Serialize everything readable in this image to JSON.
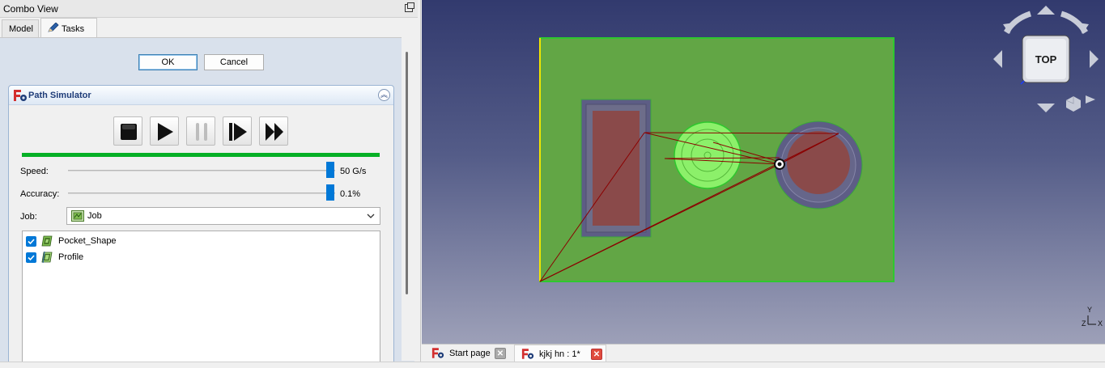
{
  "combo_view": {
    "title": "Combo View",
    "tabs": [
      {
        "label": "Model"
      },
      {
        "label": "Tasks"
      }
    ]
  },
  "dialog": {
    "ok_label": "OK",
    "cancel_label": "Cancel"
  },
  "path_simulator": {
    "title": "Path Simulator",
    "controls": [
      "stop",
      "play",
      "pause",
      "step-forward",
      "fast-forward"
    ],
    "progress": 1.0,
    "speed": {
      "label": "Speed:",
      "value": "50 G/s",
      "level": 1.0
    },
    "accuracy": {
      "label": "Accuracy:",
      "value": "0.1%",
      "level": 1.0
    },
    "job": {
      "label": "Job:",
      "selected": "Job"
    },
    "operations": [
      {
        "label": "Pocket_Shape",
        "checked": true,
        "icon": "pocket-shape-icon"
      },
      {
        "label": "Profile",
        "checked": true,
        "icon": "profile-icon"
      }
    ]
  },
  "navigation_cube": {
    "face": "TOP"
  },
  "axis_indicator": {
    "y": "Y",
    "z": "Z",
    "x": "X"
  },
  "document_tabs": [
    {
      "label": "Start page",
      "active": false
    },
    {
      "label": "kjkj hn : 1*",
      "active": true
    }
  ],
  "colors": {
    "stock": "#62a645",
    "stock_edge": "#2ec82e",
    "toolpath": "#8b0000",
    "pocket_floor": "#8a4a4a",
    "boss": "#8cf06a",
    "progress": "#06b025",
    "slider": "#0078d7"
  }
}
